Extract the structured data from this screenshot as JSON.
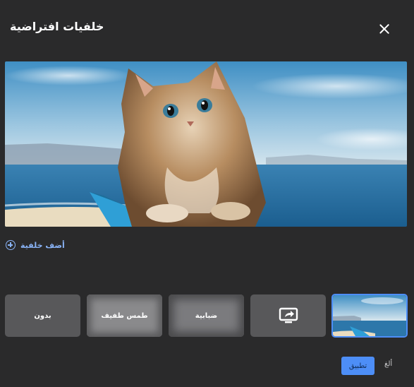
{
  "dialog": {
    "title": "خلفيات افتراضية"
  },
  "add_background": {
    "label": "أضف خلفية",
    "icon": "plus-circle-icon"
  },
  "tiles": [
    {
      "label": "بدون"
    },
    {
      "label": "طمس طفيف"
    },
    {
      "label": "ضبابية"
    },
    {
      "icon": "screen-share-icon"
    },
    {
      "selected": true
    }
  ],
  "footer": {
    "apply_label": "تطبيق",
    "cancel_label": "ألغ"
  },
  "colors": {
    "accent": "#4d8ef7",
    "link": "#8ab4f8",
    "background": "#2a2a2b"
  }
}
